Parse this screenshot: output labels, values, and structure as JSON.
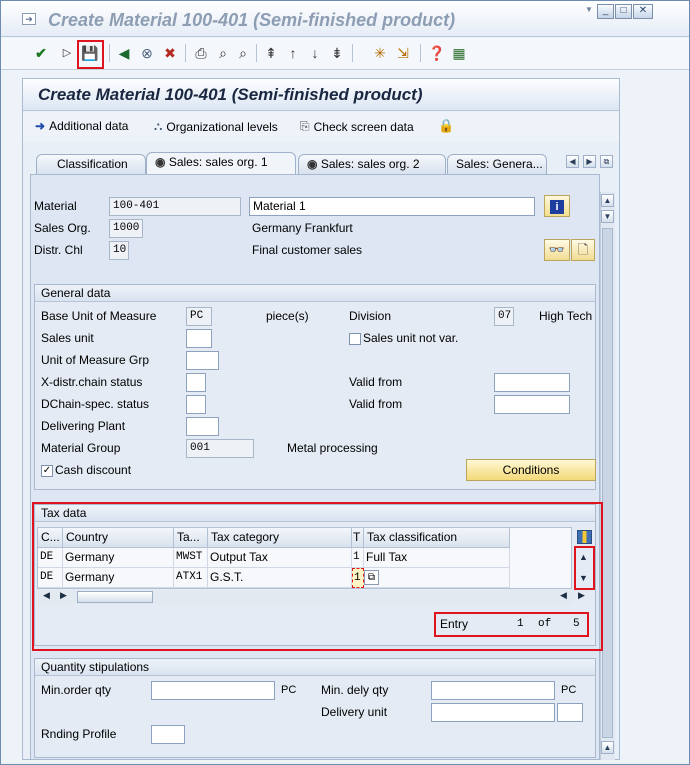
{
  "window": {
    "title": "Create Material 100-401 (Semi-finished product)",
    "buttons": [
      "_",
      "□",
      "✕"
    ]
  },
  "header": {
    "title": "Create Material 100-401 (Semi-finished product)"
  },
  "app_toolbar": {
    "additional_data": "Additional data",
    "org_levels": "Organizational levels",
    "check_screen": "Check screen data"
  },
  "tabs": [
    {
      "label": "Classification"
    },
    {
      "label": "Sales: sales org. 1"
    },
    {
      "label": "Sales: sales org. 2"
    },
    {
      "label": "Sales: Genera..."
    }
  ],
  "top": {
    "material_label": "Material",
    "material_value": "100-401",
    "material_desc": "Material 1",
    "salesorg_label": "Sales Org.",
    "salesorg_value": "1000",
    "salesorg_desc": "Germany Frankfurt",
    "distr_label": "Distr. Chl",
    "distr_value": "10",
    "distr_desc": "Final customer sales"
  },
  "general": {
    "title": "General data",
    "buom_label": "Base Unit of Measure",
    "buom_value": "PC",
    "buom_desc": "piece(s)",
    "division_label": "Division",
    "division_value": "07",
    "division_desc": "High Tech",
    "sales_unit_label": "Sales unit",
    "sales_unit_notvar": "Sales unit not var.",
    "uom_grp_label": "Unit of Measure Grp",
    "xdistr_label": "X-distr.chain status",
    "valid_from_label": "Valid from",
    "dchain_label": "DChain-spec. status",
    "valid_from2_label": "Valid from",
    "deliv_label": "Delivering Plant",
    "matgrp_label": "Material Group",
    "matgrp_value": "001",
    "matgrp_desc": "Metal processing",
    "cash_label": "Cash discount",
    "cash_checked": "✓",
    "conditions": "Conditions"
  },
  "tax": {
    "title": "Tax data",
    "headers": [
      "C...",
      "Country",
      "Ta...",
      "Tax category",
      "T",
      "Tax classification"
    ],
    "rows": [
      {
        "c": "DE",
        "country": "Germany",
        "ta": "MWST",
        "cat": "Output Tax",
        "t": "1",
        "cls": "Full Tax"
      },
      {
        "c": "DE",
        "country": "Germany",
        "ta": "ATX1",
        "cat": "G.S.T.",
        "t": "1",
        "cls": ""
      }
    ],
    "entry_label": "Entry",
    "entry_current": "1",
    "entry_of": "of",
    "entry_total": "5"
  },
  "qty": {
    "title": "Quantity stipulations",
    "min_order_label": "Min.order qty",
    "min_order_unit": "PC",
    "min_dely_label": "Min. dely qty",
    "min_dely_unit": "PC",
    "delivery_unit_label": "Delivery unit",
    "rnding_label": "Rnding Profile"
  },
  "colors": {
    "highlight": "#e0141e",
    "title_gray": "#8d9db3"
  }
}
